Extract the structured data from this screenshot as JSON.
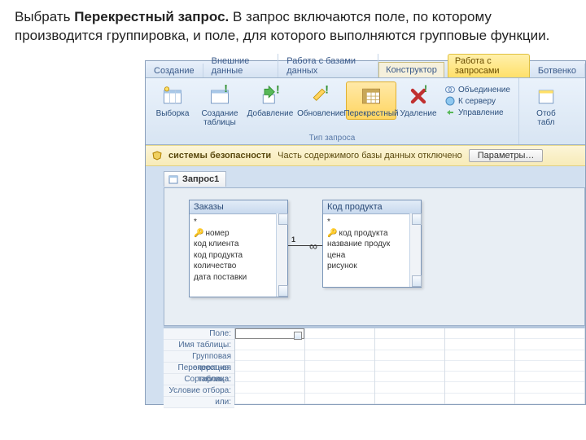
{
  "caption": {
    "prefix": "Выбрать ",
    "bold": "Перекрестный запрос.",
    "rest": " В запрос включаются поле, по которому производится группировка, и поле, для которого выполняются групповые функции."
  },
  "tabs": {
    "create": "Создание",
    "external": "Внешние данные",
    "dbtools": "Работа с базами данных",
    "context_group": "Работа с запросами",
    "context_extra": "Ботвенко",
    "constructor": "Конструктор"
  },
  "ribbon": {
    "select": "Выборка",
    "make_table": "Создание\nтаблицы",
    "append": "Добавление",
    "update": "Обновление",
    "crosstab": "Перекрестный",
    "delete": "Удаление",
    "union": "Объединение",
    "passthrough": "К серверу",
    "datadef": "Управление",
    "group_label": "Тип запроса",
    "show_table": "Отоб\nтабл"
  },
  "security": {
    "title": "системы безопасности",
    "msg": "Часть содержимого базы данных отключено",
    "btn": "Параметры…"
  },
  "doc_tab": "Запрос1",
  "tables": {
    "orders": {
      "title": "Заказы",
      "star": "*",
      "fields": [
        "номер",
        "код клиента",
        "код продукта",
        "количество",
        "дата поставки"
      ]
    },
    "product": {
      "title": "Код продукта",
      "star": "*",
      "fields": [
        "код продукта",
        "название продук",
        "цена",
        "рисунок"
      ]
    }
  },
  "relation": {
    "one": "1",
    "many": "∞"
  },
  "grid_labels": [
    "Поле:",
    "Имя таблицы:",
    "Групповая операция:",
    "Перекрестная таблица:",
    "Сортировка:",
    "Условие отбора:",
    "или:"
  ]
}
